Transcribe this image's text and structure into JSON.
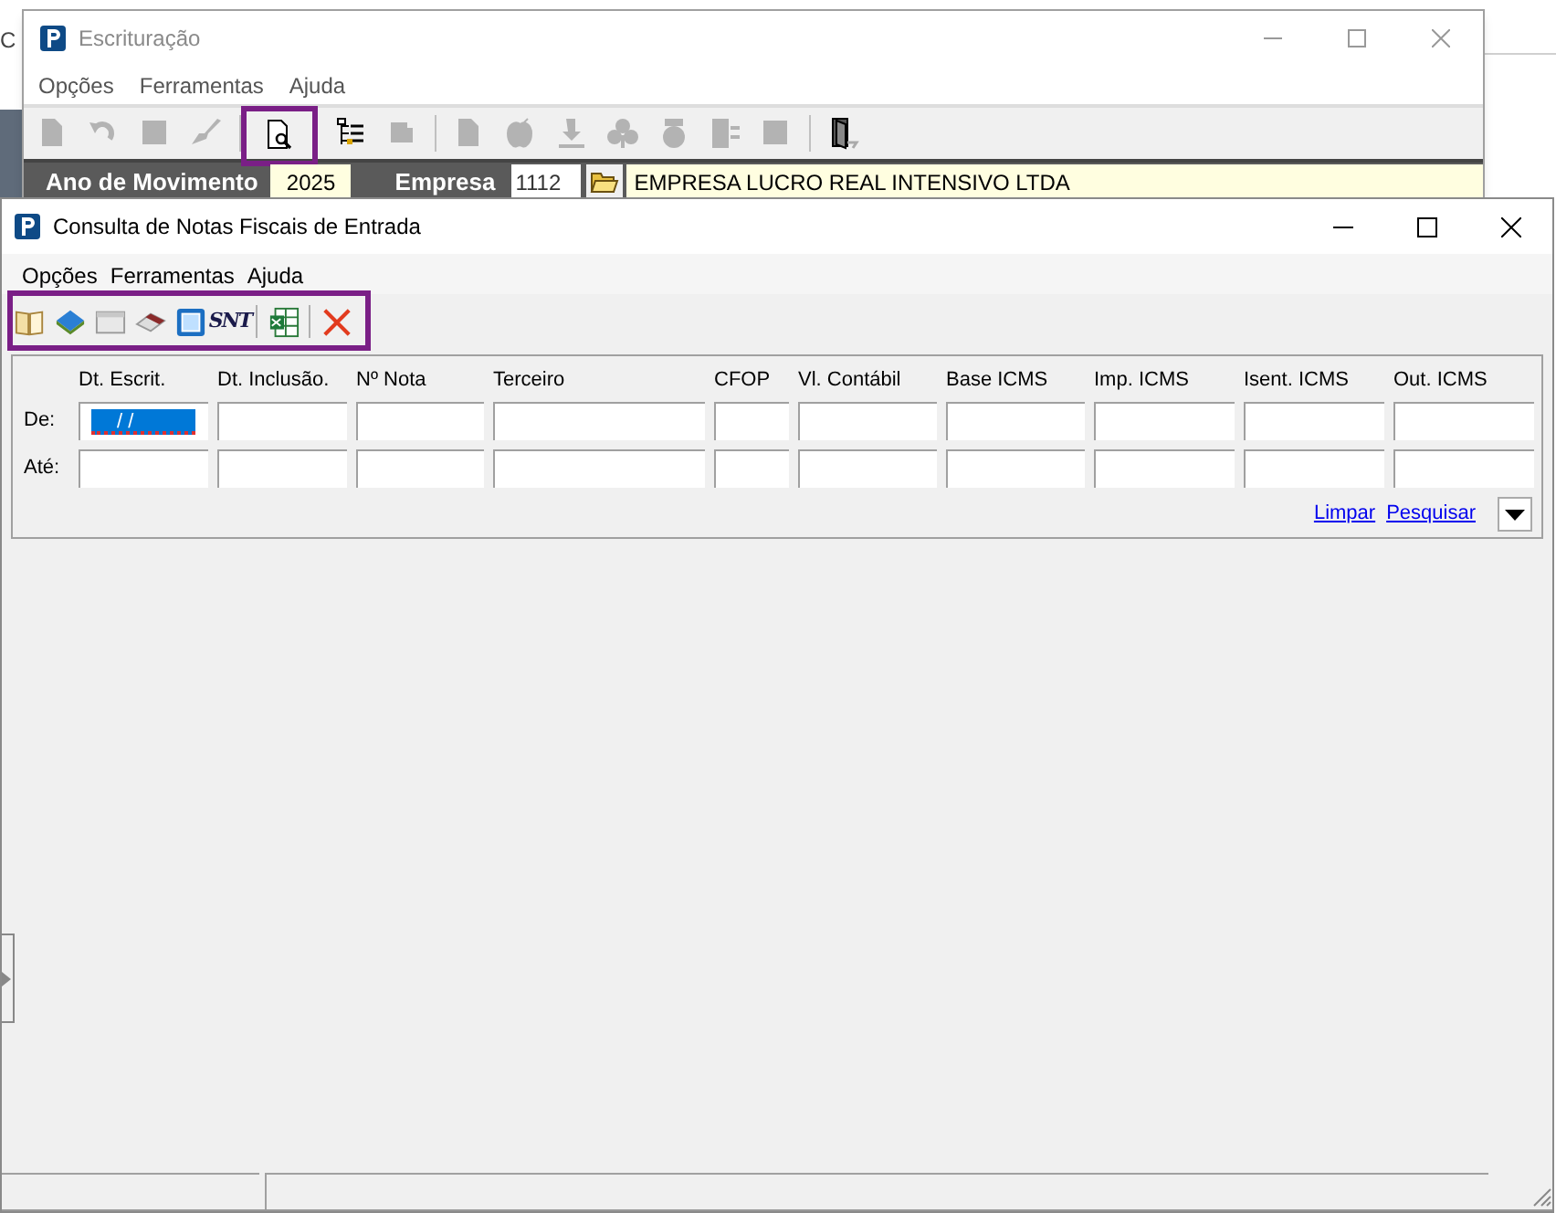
{
  "background_window": {
    "partial_title": "C"
  },
  "main_window": {
    "title": "Escrituração",
    "menu": [
      "Opções",
      "Ferramentas",
      "Ajuda"
    ],
    "toolbar": [
      {
        "kind": "doc",
        "disabled": true
      },
      {
        "kind": "undo",
        "disabled": true
      },
      {
        "kind": "square",
        "disabled": true
      },
      {
        "kind": "brush",
        "disabled": true
      },
      {
        "kind": "separator"
      },
      {
        "kind": "preview",
        "disabled": false
      },
      {
        "kind": "tree",
        "disabled": false
      },
      {
        "kind": "stamp",
        "disabled": true
      },
      {
        "kind": "separator"
      },
      {
        "kind": "doc",
        "disabled": true
      },
      {
        "kind": "apple",
        "disabled": true
      },
      {
        "kind": "download",
        "disabled": true
      },
      {
        "kind": "club",
        "disabled": true
      },
      {
        "kind": "pot",
        "disabled": true
      },
      {
        "kind": "list",
        "disabled": true
      },
      {
        "kind": "square",
        "disabled": true
      },
      {
        "kind": "separator"
      },
      {
        "kind": "exit",
        "disabled": false
      }
    ],
    "header": {
      "year_label": "Ano de Movimento",
      "year": "2025",
      "company_label": "Empresa",
      "company_code": "1112",
      "company_name": "EMPRESA LUCRO REAL INTENSIVO LTDA"
    }
  },
  "dialog": {
    "title": "Consulta de Notas Fiscais de Entrada",
    "menu": [
      "Opções",
      "Ferramentas",
      "Ajuda"
    ],
    "toolbar": [
      {
        "kind": "book-open"
      },
      {
        "kind": "book"
      },
      {
        "kind": "window"
      },
      {
        "kind": "eraser"
      },
      {
        "kind": "blue-square"
      },
      {
        "kind": "logo",
        "text": "SNT"
      },
      {
        "kind": "separator"
      },
      {
        "kind": "spreadsheet"
      },
      {
        "kind": "separator"
      },
      {
        "kind": "close"
      }
    ],
    "filter": {
      "columns": [
        "Dt. Escrit.",
        "Dt. Inclusão.",
        "Nº Nota",
        "Terceiro",
        "CFOP",
        "Vl. Contábil",
        "Base ICMS",
        "Imp. ICMS",
        "Isent. ICMS",
        "Out. ICMS"
      ],
      "rows": [
        {
          "label": "De:",
          "fields": [
            {
              "selected": true,
              "value": "/ /"
            },
            {
              "selected": false
            },
            {
              "selected": false
            },
            {
              "selected": false
            },
            {
              "selected": false
            },
            {
              "selected": false
            },
            {
              "selected": false
            },
            {
              "selected": false
            },
            {
              "selected": false
            },
            {
              "selected": false
            }
          ]
        },
        {
          "label": "Até:",
          "fields": [
            {
              "selected": false
            },
            {
              "selected": false
            },
            {
              "selected": false
            },
            {
              "selected": false
            },
            {
              "selected": false
            },
            {
              "selected": false
            },
            {
              "selected": false
            },
            {
              "selected": false
            },
            {
              "selected": false
            },
            {
              "selected": false
            }
          ]
        }
      ],
      "links": [
        "Limpar",
        "Pesquisar"
      ]
    }
  }
}
